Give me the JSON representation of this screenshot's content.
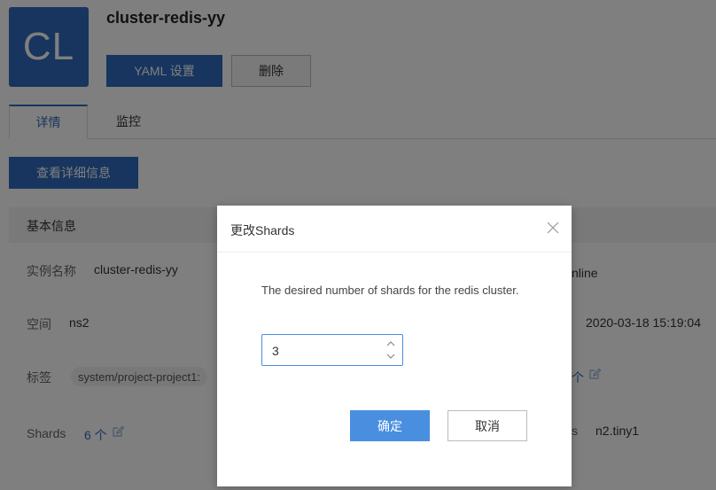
{
  "instance": {
    "avatar_text": "CL",
    "title": "cluster-redis-yy",
    "yaml_button": "YAML 设置",
    "delete_button": "删除"
  },
  "tabs": [
    {
      "label": "详情",
      "active": true
    },
    {
      "label": "监控",
      "active": false
    }
  ],
  "view_details_button": "查看详细信息",
  "basic_info": {
    "section_title": "基本信息",
    "instance_name_label": "实例名称",
    "instance_name_value": "cluster-redis-yy",
    "status_value_partial": "nline",
    "namespace_label": "空间",
    "namespace_value": "ns2",
    "created_time_value": "2020-03-18 15:19:04",
    "tags_label": "标签",
    "tag_value": "system/project-project1:",
    "tag_count_partial": "个",
    "shards_label": "Shards",
    "shards_value": "6 个",
    "flavor_label_partial": "s",
    "flavor_value": "n2.tiny1"
  },
  "modal": {
    "title": "更改Shards",
    "description": "The desired number of shards for the redis cluster.",
    "shards_input_value": "3",
    "confirm_button": "确定",
    "cancel_button": "取消"
  },
  "colors": {
    "primary": "#2f6bbd",
    "confirm": "#4a8ee0"
  },
  "icons": [
    "edit-icon",
    "close-icon",
    "chevron-up-icon",
    "chevron-down-icon"
  ]
}
